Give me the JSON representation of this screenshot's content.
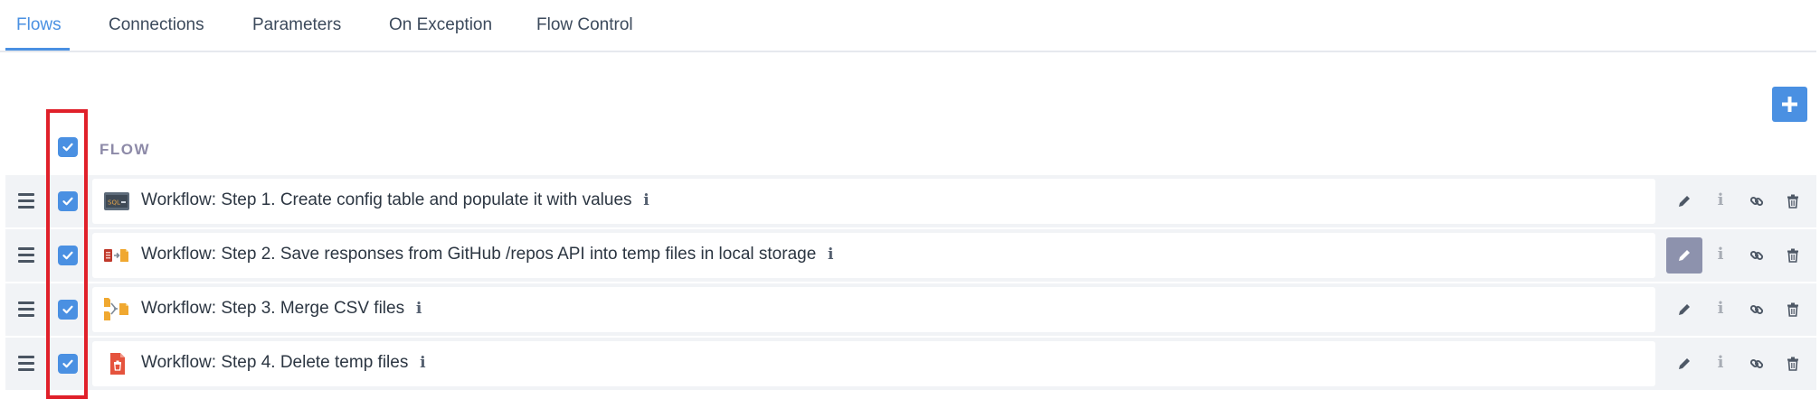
{
  "tabs": [
    {
      "label": "Flows",
      "active": true
    },
    {
      "label": "Connections",
      "active": false
    },
    {
      "label": "Parameters",
      "active": false
    },
    {
      "label": "On Exception",
      "active": false
    },
    {
      "label": "Flow Control",
      "active": false
    }
  ],
  "table": {
    "header_label": "FLOW",
    "select_all_checked": true
  },
  "rows": [
    {
      "title": "Workflow: Step 1. Create config table and populate it with values",
      "icon": "sql-icon",
      "checked": true,
      "edit_active": false
    },
    {
      "title": "Workflow: Step 2. Save responses from GitHub /repos API into temp files in local storage",
      "icon": "api-to-file-icon",
      "checked": true,
      "edit_active": true
    },
    {
      "title": "Workflow: Step 3. Merge CSV files",
      "icon": "merge-files-icon",
      "checked": true,
      "edit_active": false
    },
    {
      "title": "Workflow: Step 4. Delete temp files",
      "icon": "delete-file-icon",
      "checked": true,
      "edit_active": false
    }
  ],
  "colors": {
    "accent": "#4a90e2",
    "highlight": "#e0202a",
    "row_bg": "#f1f3f6",
    "edit_active_bg": "#8d92ad"
  }
}
